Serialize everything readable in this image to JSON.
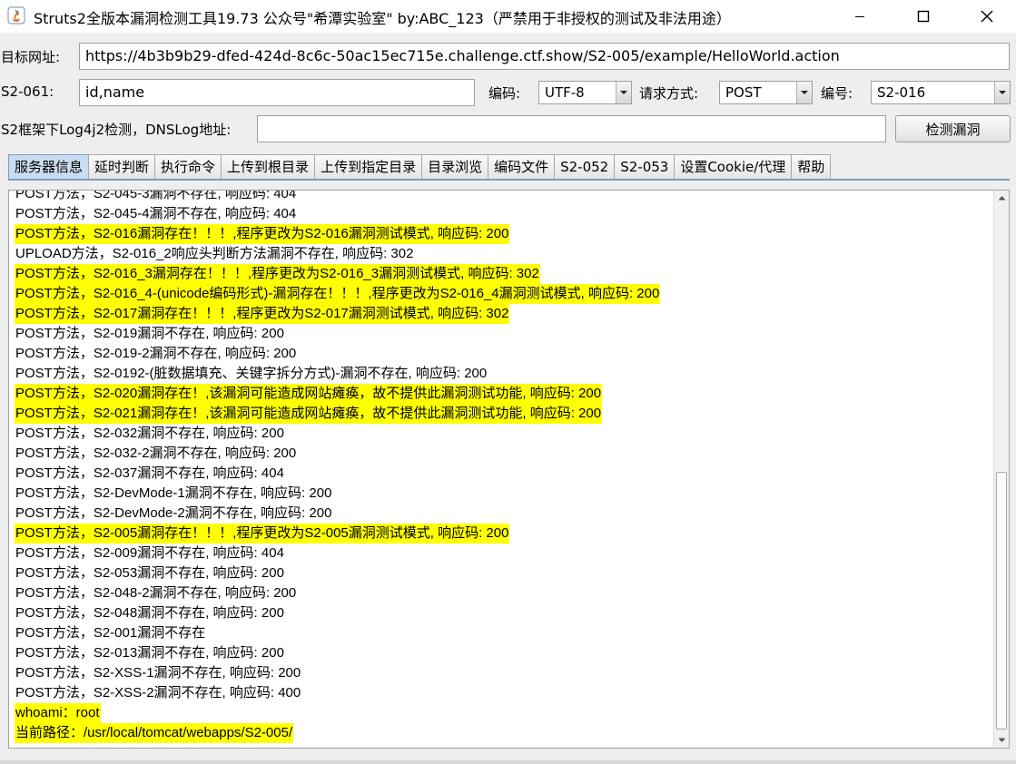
{
  "window": {
    "title": "Struts2全版本漏洞检测工具19.73 公众号\"希潭实验室\" by:ABC_123（严禁用于非授权的测试及非法用途）"
  },
  "form": {
    "target_label": "目标网址:",
    "target_value": "https://4b3b9b29-dfed-424d-8c6c-50ac15ec715e.challenge.ctf.show/S2-005/example/HelloWorld.action",
    "s2061_label": "S2-061:",
    "s2061_value": "id,name",
    "encoding_label": "编码:",
    "encoding_value": "UTF-8",
    "method_label": "请求方式:",
    "method_value": "POST",
    "number_label": "编号:",
    "number_value": "S2-016",
    "dnslog_label": "S2框架下Log4j2检测，DNSLog地址:",
    "dnslog_value": "",
    "detect_button": "检测漏洞"
  },
  "tabs": [
    {
      "label": "服务器信息",
      "active": true
    },
    {
      "label": "延时判断"
    },
    {
      "label": "执行命令"
    },
    {
      "label": "上传到根目录"
    },
    {
      "label": "上传到指定目录"
    },
    {
      "label": "目录浏览"
    },
    {
      "label": "编码文件"
    },
    {
      "label": "S2-052"
    },
    {
      "label": "S2-053"
    },
    {
      "label": "设置Cookie/代理"
    },
    {
      "label": "帮助"
    }
  ],
  "highlight_color": "#ffff00",
  "log": [
    {
      "text": "POST方法，S2-045-3漏洞不存在, 响应码: 404",
      "hl": false
    },
    {
      "text": "POST方法，S2-045-4漏洞不存在, 响应码: 404",
      "hl": false
    },
    {
      "text": "POST方法，S2-016漏洞存在！！！,程序更改为S2-016漏洞测试模式, 响应码: 200",
      "hl": true
    },
    {
      "text": "UPLOAD方法，S2-016_2响应头判断方法漏洞不存在, 响应码: 302",
      "hl": false
    },
    {
      "text": "POST方法，S2-016_3漏洞存在！！！,程序更改为S2-016_3漏洞测试模式, 响应码: 302",
      "hl": true
    },
    {
      "text": "POST方法，S2-016_4-(unicode编码形式)-漏洞存在！！！,程序更改为S2-016_4漏洞测试模式, 响应码: 200",
      "hl": true
    },
    {
      "text": "POST方法，S2-017漏洞存在！！！,程序更改为S2-017漏洞测试模式, 响应码: 302",
      "hl": true
    },
    {
      "text": "POST方法，S2-019漏洞不存在, 响应码: 200",
      "hl": false
    },
    {
      "text": "POST方法，S2-019-2漏洞不存在, 响应码: 200",
      "hl": false
    },
    {
      "text": "POST方法，S2-0192-(脏数据填充、关键字拆分方式)-漏洞不存在, 响应码: 200",
      "hl": false
    },
    {
      "text": "POST方法，S2-020漏洞存在！,该漏洞可能造成网站瘫痪，故不提供此漏洞测试功能, 响应码: 200",
      "hl": true
    },
    {
      "text": "POST方法，S2-021漏洞存在！,该漏洞可能造成网站瘫痪，故不提供此漏洞测试功能, 响应码: 200",
      "hl": true
    },
    {
      "text": "POST方法，S2-032漏洞不存在, 响应码: 200",
      "hl": false
    },
    {
      "text": "POST方法，S2-032-2漏洞不存在, 响应码: 200",
      "hl": false
    },
    {
      "text": "POST方法，S2-037漏洞不存在, 响应码: 404",
      "hl": false
    },
    {
      "text": "POST方法，S2-DevMode-1漏洞不存在, 响应码: 200",
      "hl": false
    },
    {
      "text": "POST方法，S2-DevMode-2漏洞不存在, 响应码: 200",
      "hl": false
    },
    {
      "text": "POST方法，S2-005漏洞存在！！！,程序更改为S2-005漏洞测试模式, 响应码: 200",
      "hl": true
    },
    {
      "text": "POST方法，S2-009漏洞不存在, 响应码: 404",
      "hl": false
    },
    {
      "text": "POST方法，S2-053漏洞不存在, 响应码: 200",
      "hl": false
    },
    {
      "text": "POST方法，S2-048-2漏洞不存在, 响应码: 200",
      "hl": false
    },
    {
      "text": "POST方法，S2-048漏洞不存在, 响应码: 200",
      "hl": false
    },
    {
      "text": "POST方法，S2-001漏洞不存在",
      "hl": false
    },
    {
      "text": "POST方法，S2-013漏洞不存在, 响应码: 200",
      "hl": false
    },
    {
      "text": "POST方法，S2-XSS-1漏洞不存在, 响应码: 200",
      "hl": false
    },
    {
      "text": "POST方法，S2-XSS-2漏洞不存在, 响应码: 400",
      "hl": false
    },
    {
      "text": "whoami：root",
      "hl": true
    },
    {
      "text": "当前路径：/usr/local/tomcat/webapps/S2-005/",
      "hl": true
    }
  ]
}
